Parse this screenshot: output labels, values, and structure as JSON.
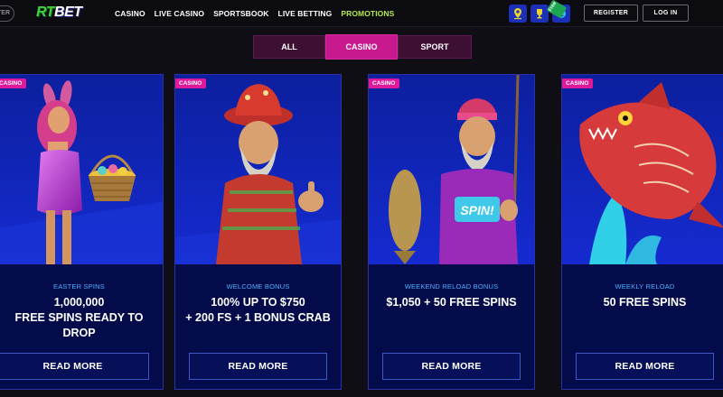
{
  "header": {
    "left_stub_text": "TER",
    "logo_part1": "RT",
    "logo_part2": "BET",
    "nav": [
      "CASINO",
      "LIVE CASINO",
      "SPORTSBOOK",
      "LIVE BETTING",
      "PROMOTIONS"
    ],
    "active_nav": "PROMOTIONS",
    "icons": [
      "map-pin-icon",
      "trophy-icon",
      "coin-icon"
    ],
    "free_tag": "Free",
    "register_label": "REGISTER",
    "login_label": "LOG IN"
  },
  "tabs": [
    {
      "label": "ALL",
      "active": false
    },
    {
      "label": "CASINO",
      "active": true
    },
    {
      "label": "SPORT",
      "active": false
    }
  ],
  "cards": [
    {
      "badge": "CASINO",
      "subtitle": "EASTER SPINS",
      "title_lines": [
        "1,000,000",
        "FREE SPINS READY TO",
        "DROP"
      ],
      "button": "READ MORE"
    },
    {
      "badge": "CASINO",
      "subtitle": "WELCOME BONUS",
      "title_lines": [
        "100% UP TO $750",
        "+ 200 FS + 1 BONUS CRAB"
      ],
      "button": "READ MORE"
    },
    {
      "badge": "CASINO",
      "subtitle": "WEEKEND RELOAD BONUS",
      "title_lines": [
        "$1,050 + 50 FREE SPINS"
      ],
      "button": "READ MORE"
    },
    {
      "badge": "CASINO",
      "subtitle": "WEEKLY RELOAD",
      "title_lines": [
        "50 FREE SPINS"
      ],
      "button": "READ MORE"
    }
  ],
  "colors": {
    "accent_pink": "#e0199a",
    "nav_active": "#b7e64a",
    "card_bg": "#040b4a",
    "subtitle_blue": "#4db2ff",
    "logo_green": "#3fd13f"
  }
}
